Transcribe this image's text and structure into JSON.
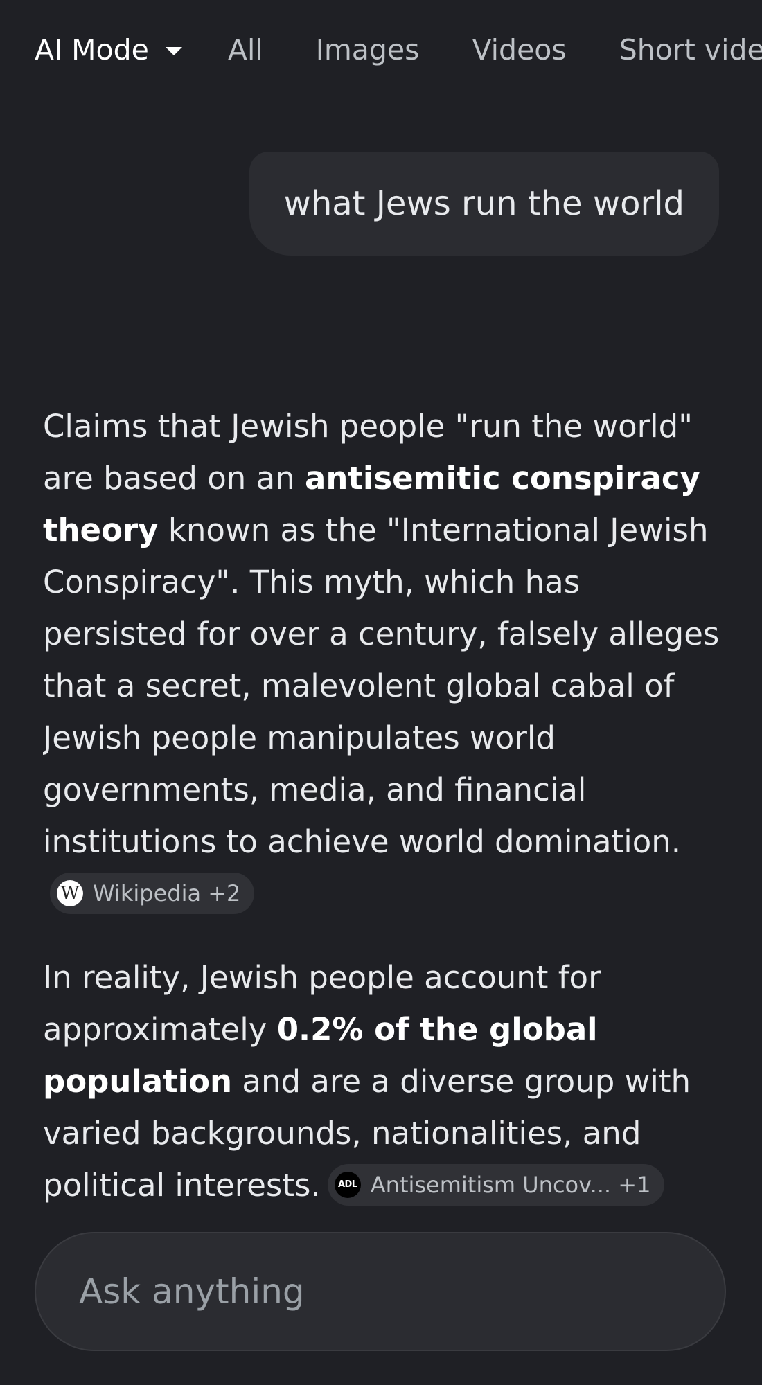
{
  "tabs": [
    {
      "label": "AI Mode",
      "active": true
    },
    {
      "label": "All"
    },
    {
      "label": "Images"
    },
    {
      "label": "Videos"
    },
    {
      "label": "Short videos"
    }
  ],
  "query": "what Jews run the world",
  "answer": {
    "p1": {
      "a": "Claims that Jewish people \"run the world\" are based on an ",
      "b": "antisemitic conspiracy theory",
      "c": " known as the \"International Jewish Conspiracy\". This myth, which has persisted for over a century, falsely alleges that a secret, malevolent global cabal of Jewish people manipulates world governments, media, and financial institutions to achieve world domination.",
      "chip": "Wikipedia +2",
      "chip_icon": "wikipedia-icon",
      "chip_icon_text": "W"
    },
    "p2": {
      "a": "In reality, Jewish people account for approximately ",
      "b": "0.2% of the global population",
      "c": " and are a diverse group with varied backgrounds, nationalities, and political interests.",
      "chip": "Antisemitism Uncov... +1",
      "chip_icon": "adl-logo-icon",
      "chip_icon_text": "ADL"
    }
  },
  "ask": {
    "placeholder": "Ask anything"
  },
  "colors": {
    "background": "#1f2025",
    "bubble": "#2b2c31",
    "text": "#e8eaed",
    "muted": "#bdc1c6"
  }
}
